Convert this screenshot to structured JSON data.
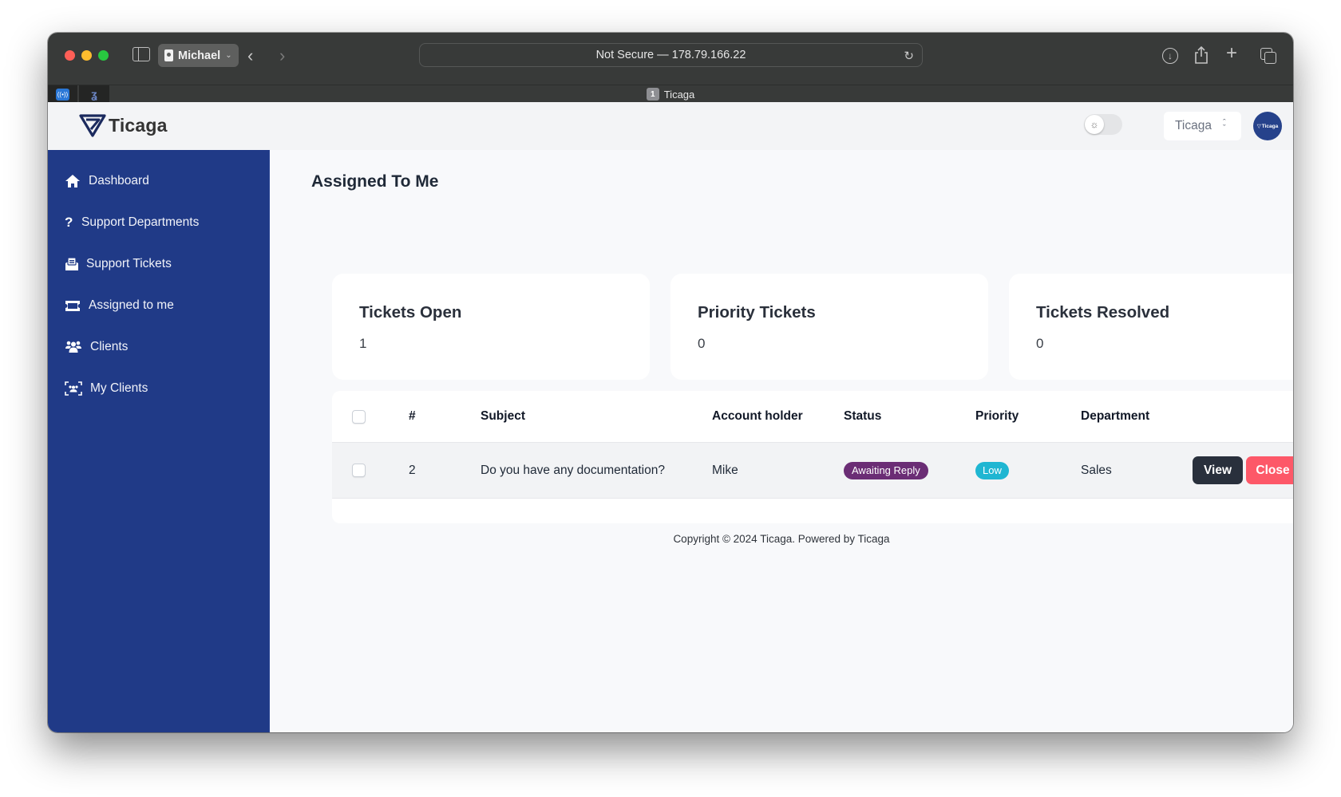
{
  "browser": {
    "profile_name": "Michael",
    "url_text": "Not Secure — 178.79.166.22",
    "active_tab": {
      "number": "1",
      "title": "Ticaga"
    },
    "pinned_tabs": [
      "radio-broadcast-icon",
      "route-icon"
    ],
    "toolbar_icons": [
      "download-icon",
      "share-icon",
      "new-tab-icon",
      "tab-overview-icon"
    ]
  },
  "header": {
    "brand": "Ticaga",
    "org_selector": "Ticaga",
    "avatar_label": "Ticaga",
    "theme_toggle": "light"
  },
  "sidebar": {
    "items": [
      {
        "label": "Dashboard",
        "icon": "home-icon"
      },
      {
        "label": "Support Departments",
        "icon": "question-icon"
      },
      {
        "label": "Support Tickets",
        "icon": "envelope-open-icon"
      },
      {
        "label": "Assigned to me",
        "icon": "ticket-icon"
      },
      {
        "label": "Clients",
        "icon": "users-icon"
      },
      {
        "label": "My Clients",
        "icon": "users-viewfinder-icon"
      }
    ]
  },
  "main": {
    "title": "Assigned To Me",
    "stats": [
      {
        "label": "Tickets Open",
        "value": "1"
      },
      {
        "label": "Priority Tickets",
        "value": "0"
      },
      {
        "label": "Tickets Resolved",
        "value": "0"
      }
    ],
    "table": {
      "columns": [
        "#",
        "Subject",
        "Account holder",
        "Status",
        "Priority",
        "Department"
      ],
      "rows": [
        {
          "id": "2",
          "subject": "Do you have any documentation?",
          "account_holder": "Mike",
          "status": "Awaiting Reply",
          "priority": "Low",
          "department": "Sales",
          "actions": {
            "view": "View",
            "close": "Close"
          }
        }
      ]
    },
    "footer": "Copyright © 2024 Ticaga. Powered by Ticaga"
  },
  "colors": {
    "sidebar_bg": "#203a87",
    "status_awaiting": "#6b2d75",
    "priority_low": "#1fb6d2",
    "view_button": "#29303c",
    "close_button": "#fd5868"
  }
}
